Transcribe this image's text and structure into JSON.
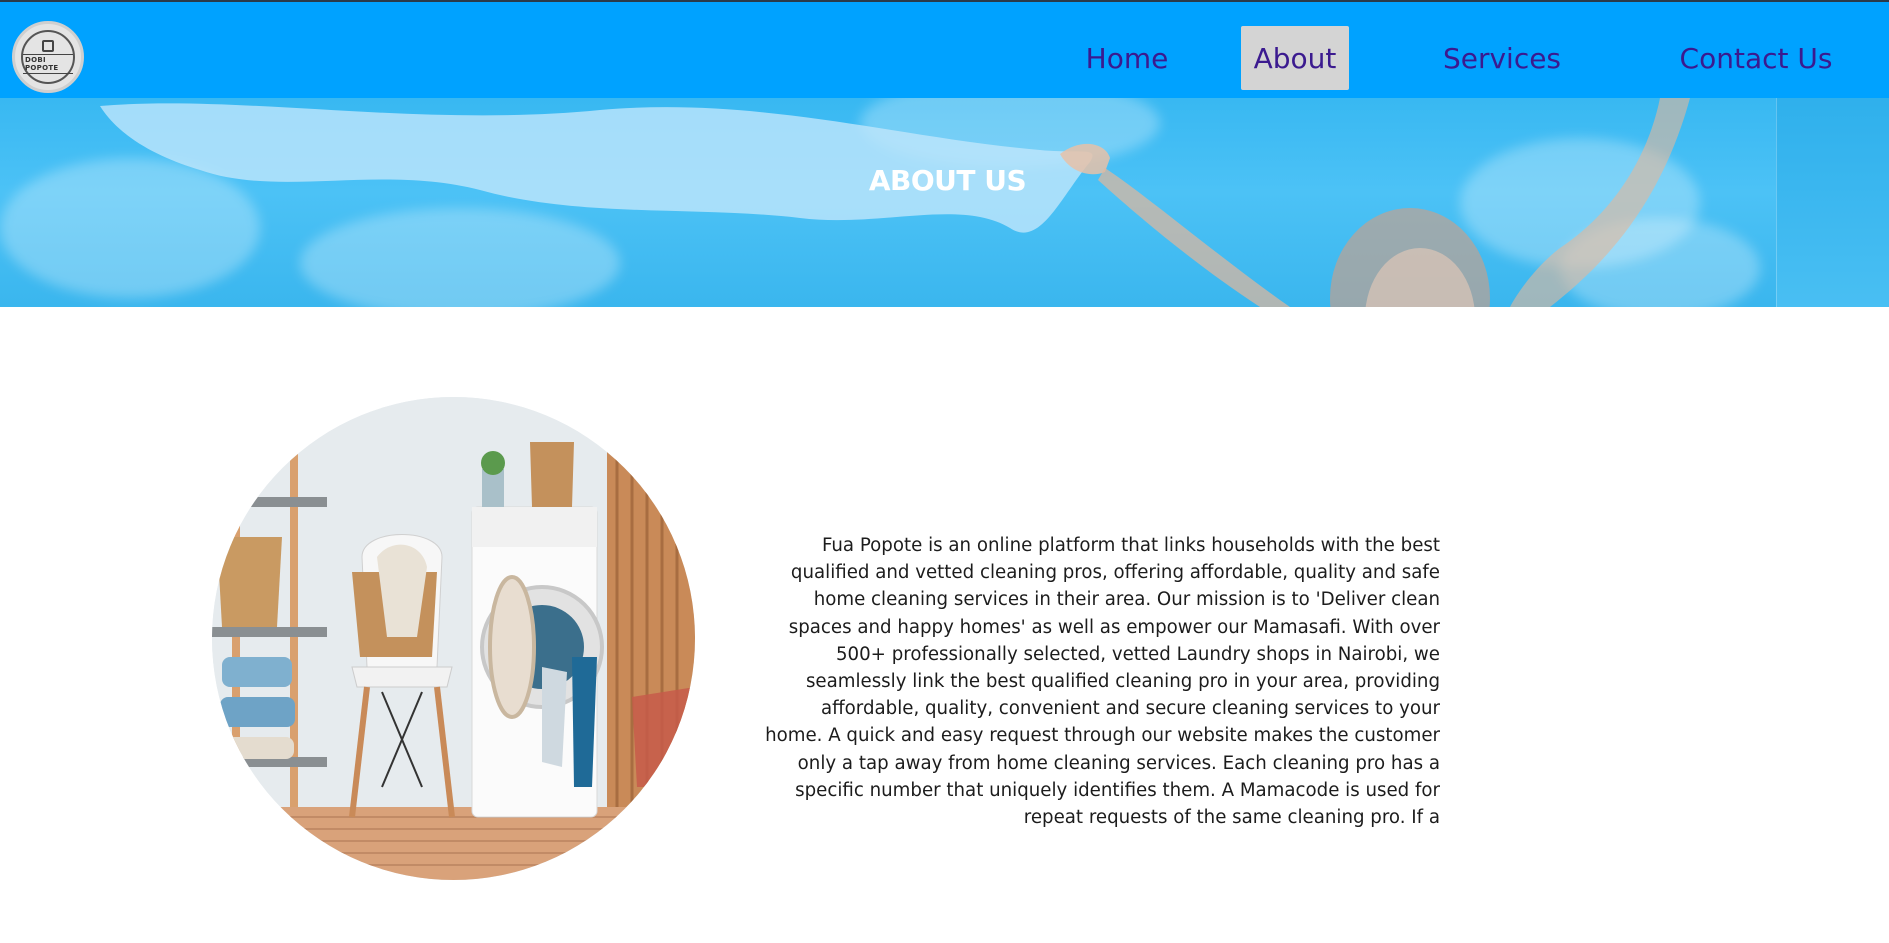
{
  "brand": {
    "logo_text": "DOBI POPOTE"
  },
  "nav": {
    "items": [
      {
        "label": "Home",
        "active": false
      },
      {
        "label": "About",
        "active": true
      },
      {
        "label": "Services",
        "active": false
      },
      {
        "label": "Contact Us",
        "active": false
      }
    ]
  },
  "hero": {
    "title": "ABOUT US"
  },
  "about": {
    "paragraph": "Fua Popote is an online platform that links households with the best qualified and vetted cleaning pros, offering affordable, quality and safe home cleaning services in their area. Our mission is to 'Deliver clean spaces and happy homes' as well as empower our Mamasafi. With over 500+ professionally selected, vetted Laundry shops in Nairobi, we seamlessly link the best qualified cleaning pro in your area, providing affordable, quality, convenient and secure cleaning services to your home. A quick and easy request through our website makes the customer only a tap away from home cleaning services. Each cleaning pro has a specific number that uniquely identifies them. A Mamacode is used for repeat requests of the same cleaning pro. If a"
  },
  "colors": {
    "navbar": "#00a2ff",
    "nav_text": "#3b1a8f",
    "nav_active_bg": "#d4d4d4",
    "hero": "#3ab6ee"
  }
}
